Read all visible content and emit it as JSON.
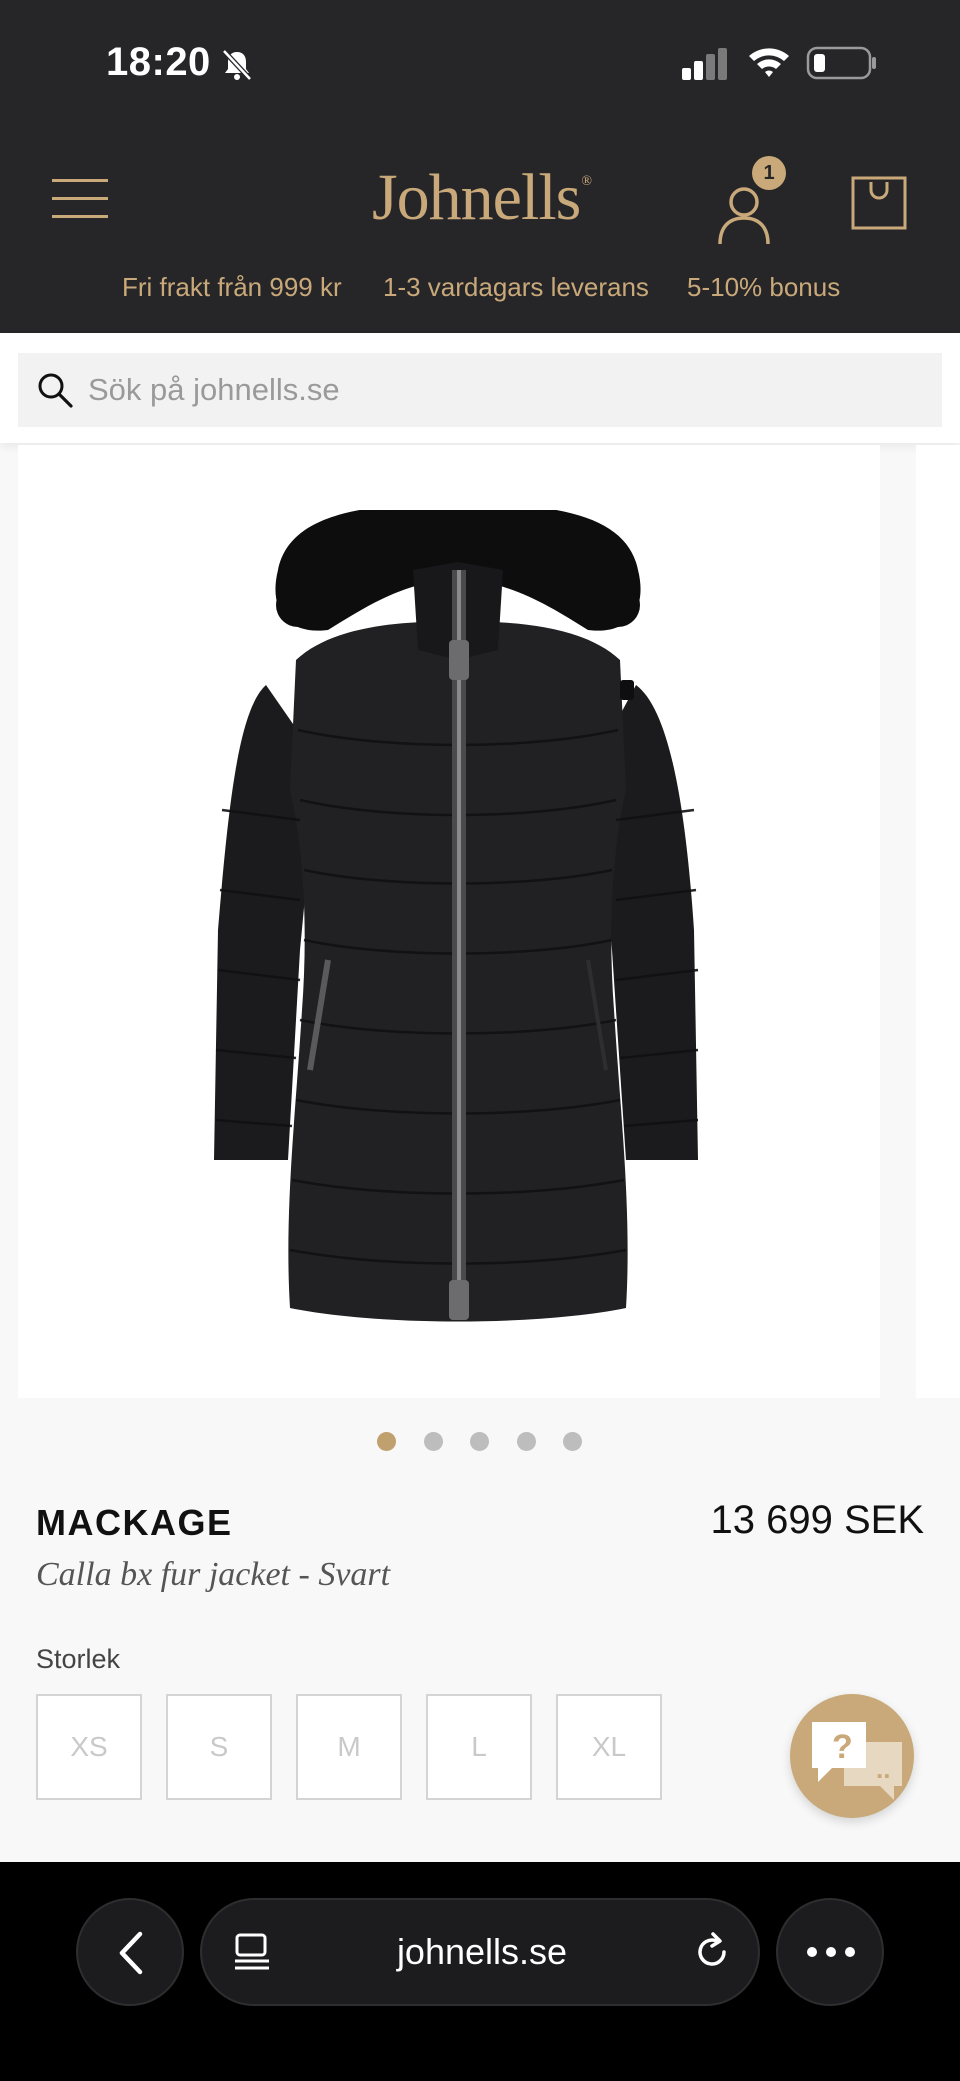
{
  "status_bar": {
    "time": "18:20",
    "icons": [
      "bell-slash-icon",
      "cellular-signal-icon",
      "wifi-icon",
      "battery-icon"
    ]
  },
  "site_header": {
    "logo_text": "Johnells",
    "logo_mark": "®",
    "cart_count": "1",
    "accent_color": "#c9a979",
    "background_color": "#262629"
  },
  "usps": [
    "Fri frakt från 999 kr",
    "1-3 vardagars leverans",
    "5-10% bonus"
  ],
  "search": {
    "placeholder": "Sök på johnells.se"
  },
  "gallery": {
    "image_count": 5,
    "active_index": 0
  },
  "product": {
    "brand": "MACKAGE",
    "name": "Calla bx fur jacket - Svart",
    "price": "13 699 SEK",
    "size_label": "Storlek",
    "sizes": [
      "XS",
      "S",
      "M",
      "L",
      "XL"
    ]
  },
  "chat": {
    "question_glyph": "?",
    "dots_glyph": ".."
  },
  "browser": {
    "url": "johnells.se"
  }
}
